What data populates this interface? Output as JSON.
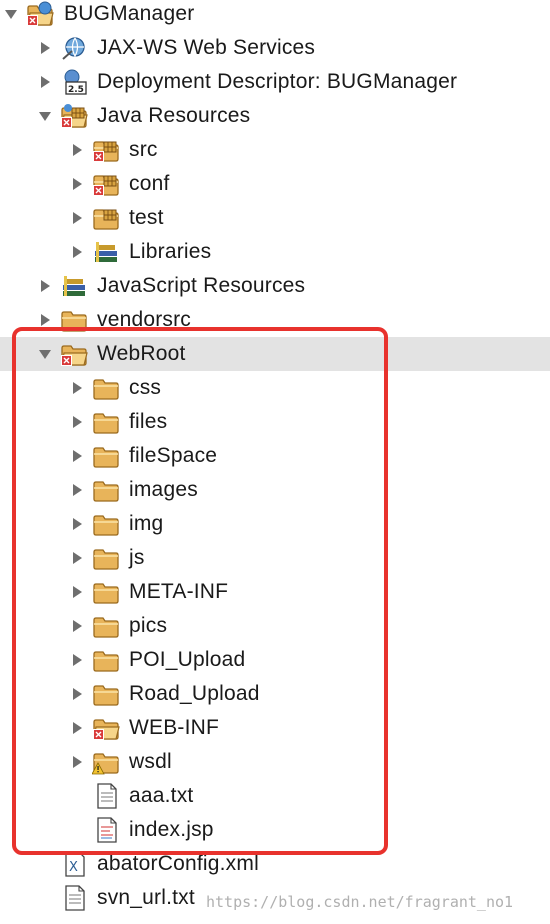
{
  "colors": {
    "highlight": "#e8322d",
    "selection": "#e3e3e3",
    "folder": "#e8b45a",
    "error": "#d93b3b"
  },
  "tree": [
    {
      "label": "BUGManager",
      "depth": 0,
      "arrow": "down",
      "icon": "project-icon"
    },
    {
      "label": "JAX-WS Web Services",
      "depth": 1,
      "arrow": "right",
      "icon": "web-services-icon"
    },
    {
      "label": "Deployment Descriptor: BUGManager",
      "depth": 1,
      "arrow": "right",
      "icon": "deployment-descriptor-icon"
    },
    {
      "label": "Java Resources",
      "depth": 1,
      "arrow": "down",
      "icon": "java-resources-icon"
    },
    {
      "label": "src",
      "depth": 2,
      "arrow": "right",
      "icon": "package-folder-error-icon"
    },
    {
      "label": "conf",
      "depth": 2,
      "arrow": "right",
      "icon": "package-folder-error-icon"
    },
    {
      "label": "test",
      "depth": 2,
      "arrow": "right",
      "icon": "package-folder-icon"
    },
    {
      "label": "Libraries",
      "depth": 2,
      "arrow": "right",
      "icon": "libraries-icon"
    },
    {
      "label": "JavaScript Resources",
      "depth": 1,
      "arrow": "right",
      "icon": "libraries-icon"
    },
    {
      "label": "vendorsrc",
      "depth": 1,
      "arrow": "right",
      "icon": "folder-icon"
    },
    {
      "label": "WebRoot",
      "depth": 1,
      "arrow": "down",
      "icon": "folder-error-icon",
      "selected": true
    },
    {
      "label": "css",
      "depth": 2,
      "arrow": "right",
      "icon": "folder-icon"
    },
    {
      "label": "files",
      "depth": 2,
      "arrow": "right",
      "icon": "folder-icon"
    },
    {
      "label": "fileSpace",
      "depth": 2,
      "arrow": "right",
      "icon": "folder-icon"
    },
    {
      "label": "images",
      "depth": 2,
      "arrow": "right",
      "icon": "folder-icon"
    },
    {
      "label": "img",
      "depth": 2,
      "arrow": "right",
      "icon": "folder-icon"
    },
    {
      "label": "js",
      "depth": 2,
      "arrow": "right",
      "icon": "folder-icon"
    },
    {
      "label": "META-INF",
      "depth": 2,
      "arrow": "right",
      "icon": "folder-icon"
    },
    {
      "label": "pics",
      "depth": 2,
      "arrow": "right",
      "icon": "folder-icon"
    },
    {
      "label": "POI_Upload",
      "depth": 2,
      "arrow": "right",
      "icon": "folder-icon"
    },
    {
      "label": "Road_Upload",
      "depth": 2,
      "arrow": "right",
      "icon": "folder-icon"
    },
    {
      "label": "WEB-INF",
      "depth": 2,
      "arrow": "right",
      "icon": "folder-error-icon"
    },
    {
      "label": "wsdl",
      "depth": 2,
      "arrow": "right",
      "icon": "folder-warning-icon"
    },
    {
      "label": "aaa.txt",
      "depth": 2,
      "arrow": "none",
      "icon": "text-file-icon"
    },
    {
      "label": "index.jsp",
      "depth": 2,
      "arrow": "none",
      "icon": "jsp-file-icon"
    },
    {
      "label": "abatorConfig.xml",
      "depth": 1,
      "arrow": "none",
      "icon": "xml-file-icon"
    },
    {
      "label": "svn_url.txt",
      "depth": 1,
      "arrow": "none",
      "icon": "text-file-icon"
    }
  ],
  "watermark": "https://blog.csdn.net/fragrant_no1"
}
